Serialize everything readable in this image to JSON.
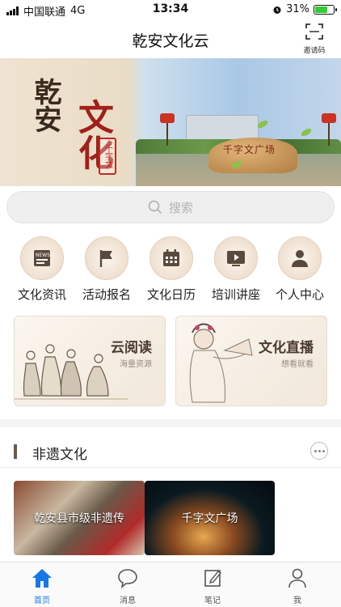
{
  "status_bar": {
    "carrier": "中国联通",
    "network": "4G",
    "time": "13:34",
    "battery": "31%"
  },
  "nav": {
    "title": "乾安文化云",
    "invite_label": "邀请码"
  },
  "banner": {
    "title_part1": "乾安",
    "title_part2": "文化",
    "seal_text": "千字文",
    "rock_text": "千字文广场"
  },
  "search": {
    "placeholder": "搜索"
  },
  "menu": [
    {
      "label": "文化资讯",
      "icon": "newspaper-icon"
    },
    {
      "label": "活动报名",
      "icon": "flag-icon"
    },
    {
      "label": "文化日历",
      "icon": "calendar-icon"
    },
    {
      "label": "培训讲座",
      "icon": "video-play-icon"
    },
    {
      "label": "个人中心",
      "icon": "person-icon"
    }
  ],
  "cards": [
    {
      "title": "云阅读",
      "subtitle": "海量资源"
    },
    {
      "title": "文化直播",
      "subtitle": "想看就看"
    }
  ],
  "section": {
    "title": "非遗文化"
  },
  "heritage": [
    {
      "label": "乾安县市级非遗传"
    },
    {
      "label": "千字文广场"
    }
  ],
  "tabs": [
    {
      "label": "首页",
      "icon": "home-icon",
      "active": true
    },
    {
      "label": "消息",
      "icon": "message-icon"
    },
    {
      "label": "笔记",
      "icon": "note-icon"
    },
    {
      "label": "我",
      "icon": "user-icon"
    }
  ],
  "colors": {
    "accent": "#1677e6",
    "icon_brown": "#5a4a3e",
    "battery": "#33cc33"
  }
}
